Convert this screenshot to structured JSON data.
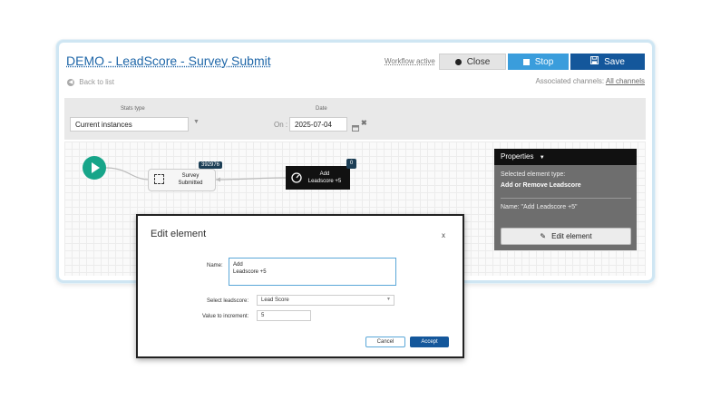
{
  "header": {
    "title": "DEMO - LeadScore - Survey Submit",
    "workflow_status": "Workflow active",
    "close_label": "Close",
    "stop_label": "Stop",
    "save_label": "Save",
    "back_label": "Back to list",
    "channels_prefix": "Associated channels:",
    "channels_link": "All channels"
  },
  "stats": {
    "stats_type_label": "Stats type",
    "stats_type_value": "Current instances",
    "date_label": "Date",
    "on_label": "On",
    "date_value": "2025-07-04"
  },
  "canvas": {
    "survey_node": {
      "label_line1": "Survey",
      "label_line2": "Submitted",
      "badge": "392976"
    },
    "lead_node": {
      "label_line1": "Add",
      "label_line2": "Leadscore +5",
      "badge": "0"
    }
  },
  "properties": {
    "header": "Properties",
    "type_label": "Selected element type:",
    "type_value": "Add or Remove Leadscore",
    "name_text": "Name: \"Add Leadscore +5\"",
    "edit_label": "Edit element"
  },
  "dialog": {
    "title": "Edit element",
    "close_label": "x",
    "name_label": "Name:",
    "name_value": "Add\nLeadscore +5",
    "leadscore_label": "Select leadscore:",
    "leadscore_value": "Lead Score",
    "increment_label": "Value to increment:",
    "increment_value": "5",
    "cancel_label": "Cancel",
    "accept_label": "Accept"
  },
  "colors": {
    "accent": "#14579b",
    "stop": "#3a9ddc",
    "start_node": "#17a589",
    "badge": "#1c3e55"
  }
}
